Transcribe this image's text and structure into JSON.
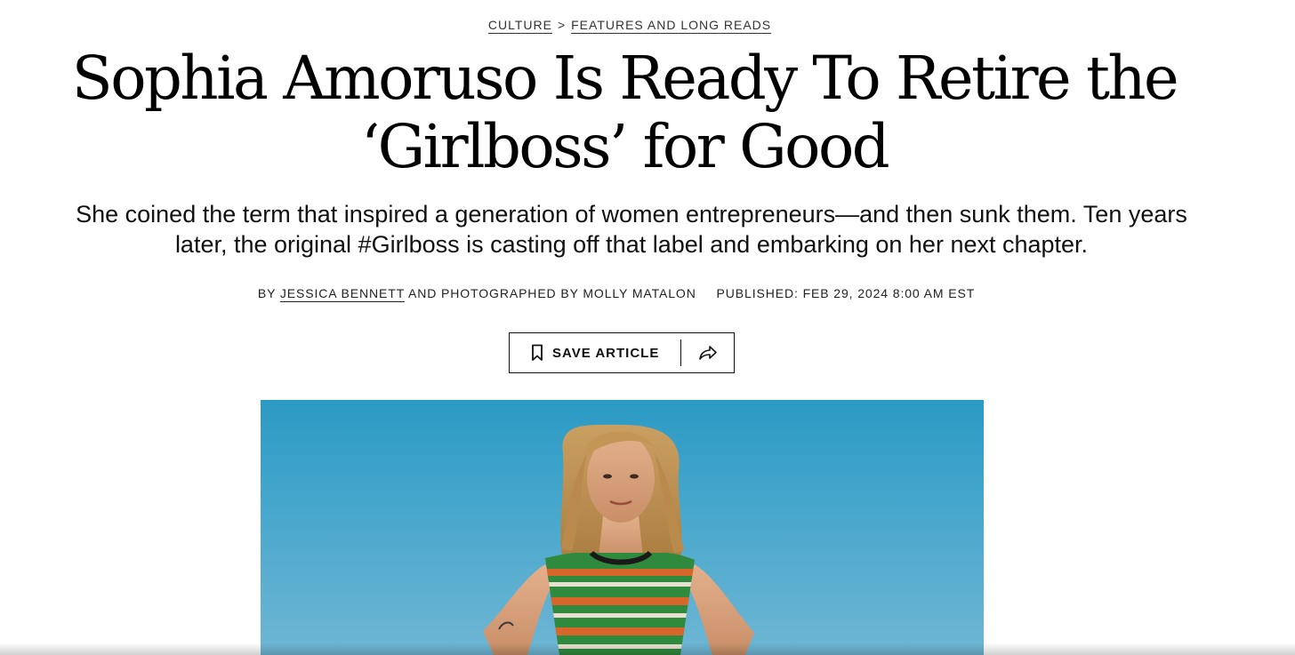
{
  "breadcrumb": {
    "items": [
      "CULTURE",
      "FEATURES AND LONG READS"
    ],
    "separator": ">"
  },
  "article": {
    "headline_line1": "Sophia Amoruso Is Ready To Retire the",
    "headline_line2": "‘Girlboss’ for Good",
    "dek": "She coined the term that inspired a generation of women entrepreneurs—and then sunk them. Ten years later, the original #Girlboss is casting off that label and embarking on her next chapter.",
    "byline_prefix": "BY",
    "author": "JESSICA BENNETT",
    "photo_credit": "AND PHOTOGRAPHED BY MOLLY MATALON",
    "published": "PUBLISHED: FEB 29, 2024 8:00 AM EST"
  },
  "actions": {
    "save_label": "SAVE ARTICLE",
    "save_icon": "bookmark-icon",
    "share_icon": "share-icon"
  },
  "colors": {
    "text": "#111111",
    "sky_top": "#2b9ac4",
    "sky_bottom": "#6fb6d4",
    "top_stripe_orange": "#d8652a",
    "top_stripe_green": "#2f8a3e"
  }
}
